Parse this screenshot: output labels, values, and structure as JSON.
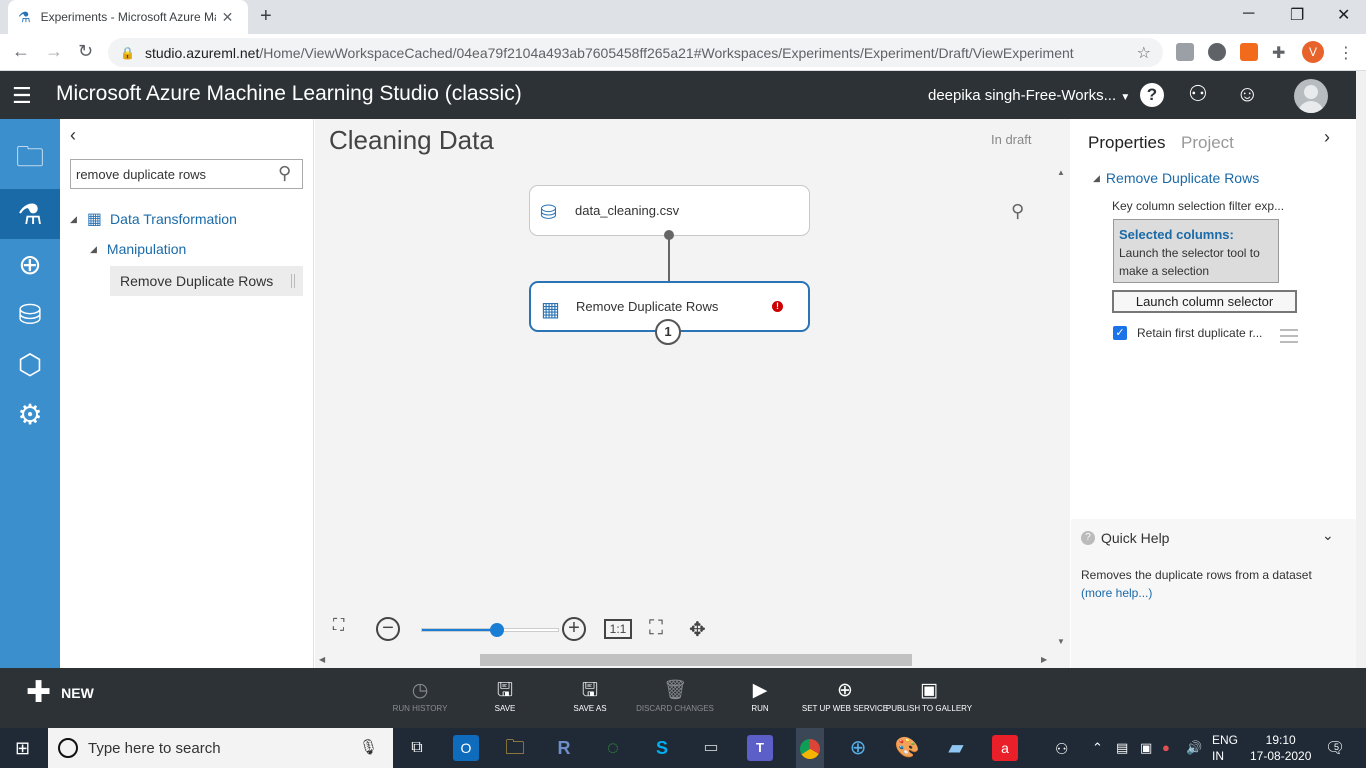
{
  "browser": {
    "tab_title": "Experiments - Microsoft Azure Machine Learning Studio (classic)",
    "url_host": "studio.azureml.net",
    "url_path": "/Home/ViewWorkspaceCached/04ea79f2104a493ab7605458ff265a21#Workspaces/Experiments/Experiment/Draft/ViewExperiment",
    "profile_initial": "V"
  },
  "header": {
    "app_title": "Microsoft Azure Machine Learning Studio (classic)",
    "workspace_user": "deepika singh-Free-Works..."
  },
  "palette": {
    "search_value": "remove duplicate rows",
    "category": "Data Transformation",
    "subcategory": "Manipulation",
    "module": "Remove Duplicate Rows"
  },
  "canvas": {
    "experiment_title": "Cleaning Data",
    "status": "In draft",
    "module_dataset": "data_cleaning.csv",
    "module_transform": "Remove Duplicate Rows",
    "error_mark": "!",
    "output_port": "1",
    "zoom_level": 0.55,
    "zoom_reset_label": "1:1"
  },
  "properties": {
    "tab_properties": "Properties",
    "tab_project": "Project",
    "module_name": "Remove Duplicate Rows",
    "key_column_label": "Key column selection filter exp...",
    "selected_title": "Selected columns:",
    "selected_text": "Launch the selector tool to make a selection",
    "launch_button": "Launch column selector",
    "retain_label": "Retain first duplicate r...",
    "retain_checked": true
  },
  "quick_help": {
    "title": "Quick Help",
    "text": "Removes the duplicate rows from a dataset",
    "more": "(more help...)"
  },
  "command_bar": {
    "new": "NEW",
    "run_history": "RUN HISTORY",
    "save": "SAVE",
    "save_as": "SAVE AS",
    "discard": "DISCARD CHANGES",
    "run": "RUN",
    "web_service": "SET UP WEB SERVICE",
    "publish": "PUBLISH TO GALLERY"
  },
  "taskbar": {
    "search_placeholder": "Type here to search",
    "lang_1": "ENG",
    "lang_2": "IN",
    "time": "19:10",
    "date": "17-08-2020",
    "notifications": "5"
  }
}
